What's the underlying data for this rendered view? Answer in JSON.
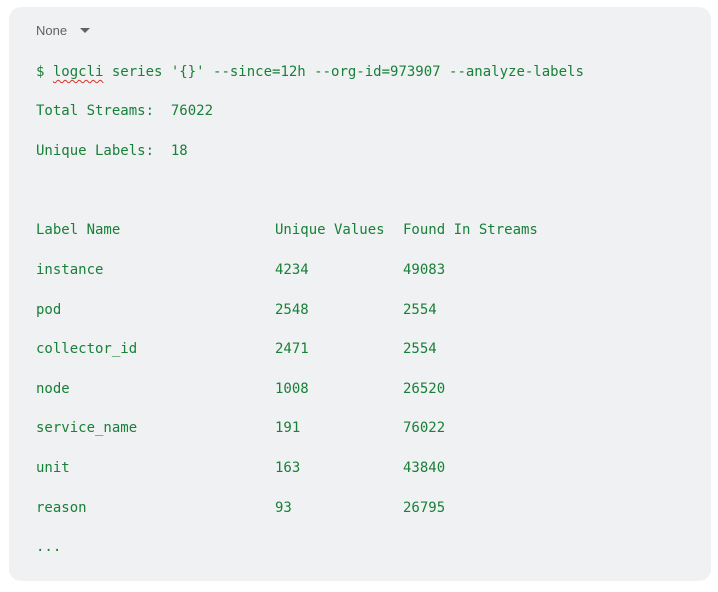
{
  "language_selector": {
    "label": "None",
    "icon": "chevron-down-icon"
  },
  "command": {
    "prompt": "$ ",
    "program": "logcli",
    "args": " series '{}' --since=12h --org-id=973907 --analyze-labels"
  },
  "summary": {
    "total_streams": "Total Streams:  76022",
    "unique_labels": "Unique Labels:  18"
  },
  "table": {
    "headers": [
      "Label Name",
      "Unique Values",
      "Found In Streams"
    ],
    "rows": [
      [
        "instance",
        "4234",
        "49083"
      ],
      [
        "pod",
        "2548",
        "2554"
      ],
      [
        "collector_id",
        "2471",
        "2554"
      ],
      [
        "node",
        "1008",
        "26520"
      ],
      [
        "service_name",
        "191",
        "76022"
      ],
      [
        "unit",
        "163",
        "43840"
      ],
      [
        "reason",
        "93",
        "26795"
      ]
    ]
  },
  "ellipsis": "...",
  "colors": {
    "code_text": "#188038",
    "background": "#f0f1f3",
    "spell_error": "#d93025"
  }
}
